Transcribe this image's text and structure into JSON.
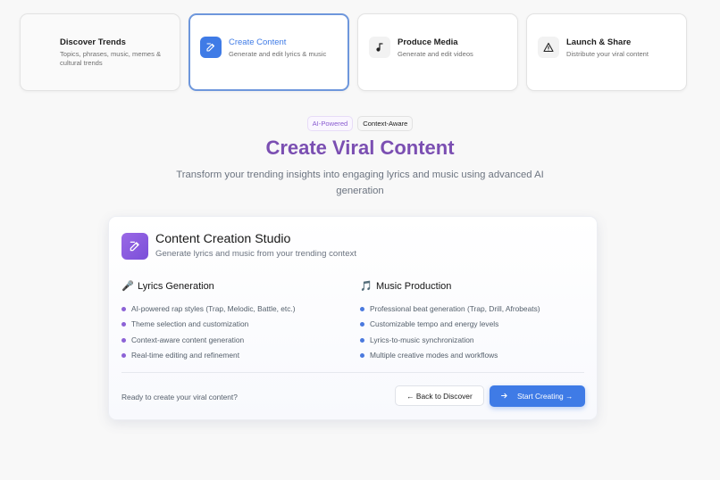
{
  "steps": [
    {
      "title": "Discover Trends",
      "desc": "Topics, phrases, music, memes & cultural trends",
      "icon": "none",
      "state": "inactive"
    },
    {
      "title": "Create Content",
      "desc": "Generate and edit lyrics & music",
      "icon": "edit-icon",
      "state": "active"
    },
    {
      "title": "Produce Media",
      "desc": "Generate and edit videos",
      "icon": "music-note-icon",
      "state": "default"
    },
    {
      "title": "Launch & Share",
      "desc": "Distribute your viral content",
      "icon": "warning-triangle-icon",
      "state": "default"
    }
  ],
  "badges": {
    "ai": "AI-Powered",
    "context": "Context-Aware"
  },
  "hero": {
    "title": "Create Viral Content",
    "subtitle": "Transform your trending insights into engaging lyrics and music using advanced AI generation"
  },
  "studio": {
    "title": "Content Creation Studio",
    "subtitle": "Generate lyrics and music from your trending context",
    "lyrics": {
      "emoji": "🎤",
      "title": "Lyrics Generation",
      "items": [
        "AI-powered rap styles (Trap, Melodic, Battle, etc.)",
        "Theme selection and customization",
        "Context-aware content generation",
        "Real-time editing and refinement"
      ]
    },
    "music": {
      "emoji": "🎵",
      "title": "Music Production",
      "items": [
        "Professional beat generation (Trap, Drill, Afrobeats)",
        "Customizable tempo and energy levels",
        "Lyrics-to-music synchronization",
        "Multiple creative modes and workflows"
      ]
    },
    "ready_text": "Ready to create your viral content?",
    "back_label": "← Back to Discover",
    "start_label": "Start Creating →"
  },
  "colors": {
    "accent_blue": "#3f7be6",
    "accent_purple": "#7b4fb2",
    "bullet_purple": "#8c62d6",
    "bullet_blue": "#4a79de"
  }
}
